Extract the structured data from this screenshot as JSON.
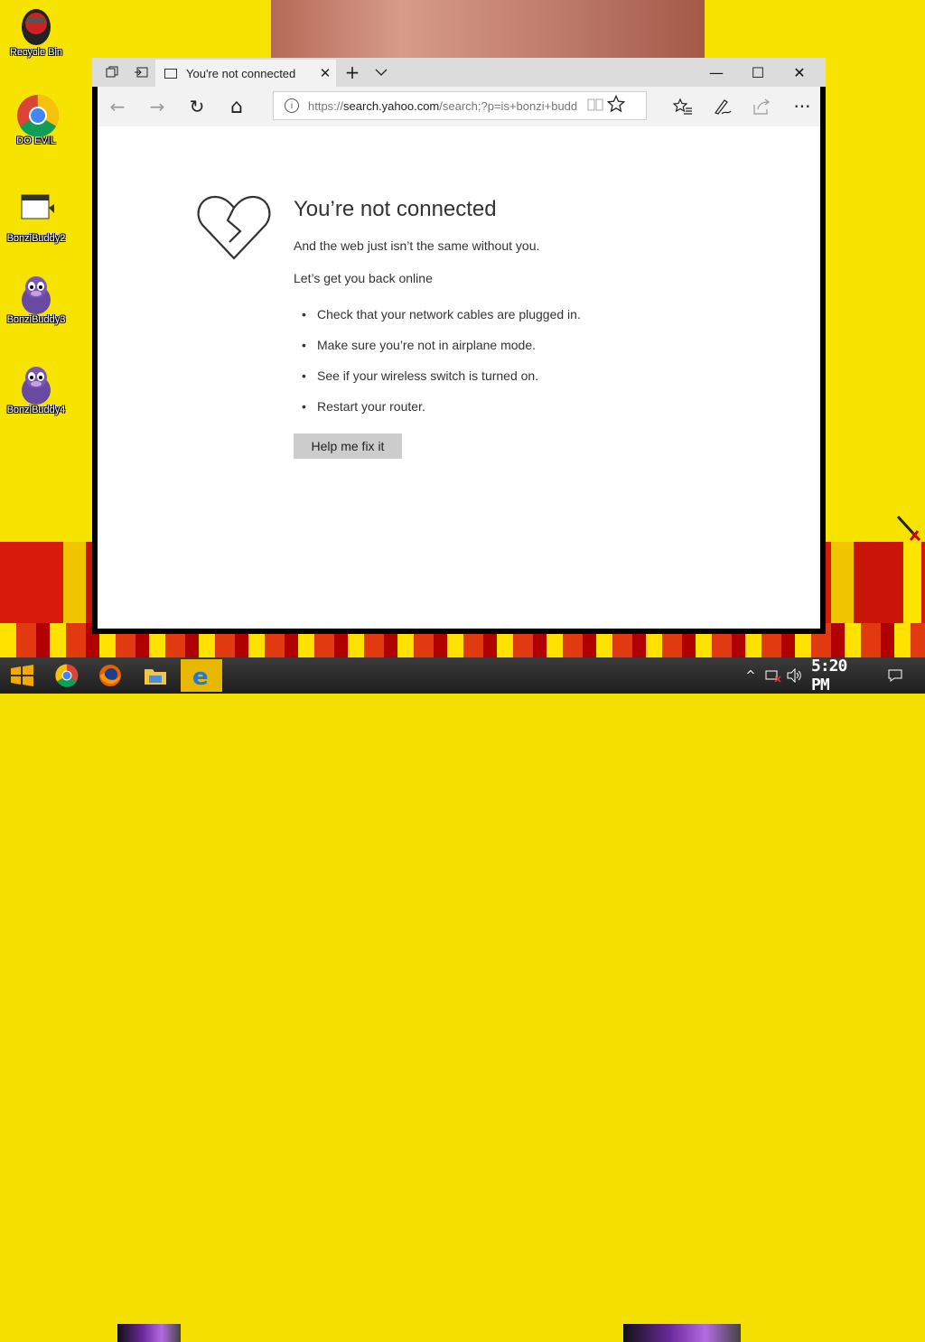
{
  "desktop": {
    "icons": [
      {
        "label": "Recycle Bin",
        "icon": "recycle-bin-icon"
      },
      {
        "label": "DO EVIL",
        "icon": "chrome-icon"
      },
      {
        "label": "BonziBuddy2",
        "icon": "video-file-icon"
      },
      {
        "label": "BonziBuddy3",
        "icon": "bonzi-gorilla-icon"
      },
      {
        "label": "BonziBuddy4",
        "icon": "bonzi-gorilla-icon"
      }
    ]
  },
  "browser": {
    "tab": {
      "title": "You're not connected",
      "close": "✕"
    },
    "new_tab": "+",
    "tab_list": "⌄",
    "window_controls": {
      "minimize": "—",
      "maximize": "☐",
      "close": "✕"
    },
    "nav": {
      "back": "←",
      "forward": "→",
      "refresh": "↻",
      "home": "⌂"
    },
    "address": {
      "scheme": "https://",
      "host": "search.yahoo.com",
      "path": "/search;?p=is+bonzi+budd"
    },
    "toolbar": {
      "favorites": "☆",
      "notes": "✎",
      "share": "⇪",
      "more": "···"
    }
  },
  "error_page": {
    "title": "You’re not connected",
    "subtitle": "And the web just isn’t the same without you.",
    "back_online": "Let’s get you back online",
    "tips": [
      "Check that your network cables are plugged in.",
      "Make sure you’re not in airplane mode.",
      "See if your wireless switch is turned on.",
      "Restart your router."
    ],
    "fix_button": "Help me fix it"
  },
  "taskbar": {
    "clock": "5:20 PM",
    "apps": [
      "start-icon",
      "chrome-icon",
      "firefox-icon",
      "file-explorer-icon",
      "edge-icon"
    ]
  },
  "colors": {
    "wallpaper": "#f6e400",
    "accent": "#e8b800",
    "button": "#cccccc"
  }
}
